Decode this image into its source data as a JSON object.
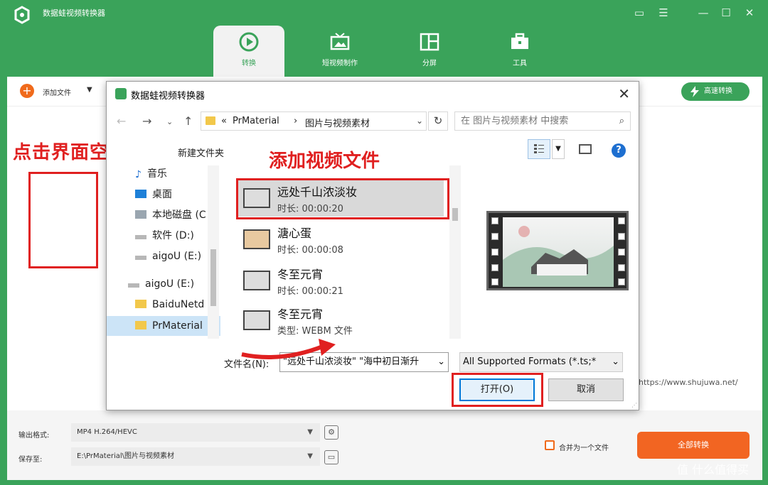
{
  "app": {
    "title": "数据蛙视频转换器",
    "tabs": [
      {
        "label": "转换",
        "active": true
      },
      {
        "label": "短视频制作"
      },
      {
        "label": "分屏"
      },
      {
        "label": "工具"
      }
    ]
  },
  "toolbar": {
    "add_label": "添加文件",
    "fast_label": "高速转换"
  },
  "annotations": {
    "left_hint": "点击界面空白处",
    "list_hint": "添加视频文件"
  },
  "site_url": "https://www.shujuwa.net/",
  "bottom": {
    "format_label": "输出格式:",
    "format_value": "MP4 H.264/HEVC",
    "save_label": "保存至:",
    "save_value": "E:\\PrMaterial\\图片与视频素材",
    "merge_label": "合并为一个文件",
    "convert_all": "全部转换"
  },
  "watermark": "值 什么值得买",
  "dialog": {
    "title": "数据蛙视频转换器",
    "address": {
      "prefix": "«",
      "part1": "PrMaterial",
      "sep": "›",
      "part2": "图片与视频素材"
    },
    "search_placeholder": "在 图片与视频素材 中搜索",
    "new_folder": "新建文件夹",
    "nav_items": [
      {
        "label": "音乐"
      },
      {
        "label": "桌面"
      },
      {
        "label": "本地磁盘 (C"
      },
      {
        "label": "软件 (D:)"
      },
      {
        "label": "aigoU (E:)"
      },
      {
        "label": "aigoU (E:)"
      },
      {
        "label": "BaiduNetd"
      },
      {
        "label": "PrMaterial",
        "selected": true
      }
    ],
    "files": [
      {
        "name": "远处千山浓淡妆",
        "meta": "时长: 00:00:20",
        "selected": true
      },
      {
        "name": "溏心蛋",
        "meta": "时长: 00:00:08"
      },
      {
        "name": "冬至元宵",
        "meta": "时长: 00:00:21"
      },
      {
        "name": "冬至元宵",
        "meta": "类型: WEBM 文件"
      }
    ],
    "filename_label": "文件名(N):",
    "filename_value": "\"远处千山浓淡妆\" \"海中初日渐升",
    "filter_value": "All Supported Formats (*.ts;*",
    "open_label": "打开(O)",
    "cancel_label": "取消"
  },
  "colors": {
    "brand_green": "#3aa35a",
    "accent_orange": "#f26522",
    "annotation_red": "#e02020"
  }
}
